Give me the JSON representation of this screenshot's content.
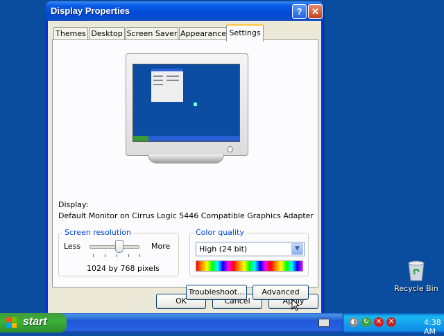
{
  "window": {
    "title": "Display Properties",
    "help_glyph": "?",
    "close_glyph": "✕"
  },
  "tabs": [
    {
      "label": "Themes"
    },
    {
      "label": "Desktop"
    },
    {
      "label": "Screen Saver"
    },
    {
      "label": "Appearance"
    },
    {
      "label": "Settings"
    }
  ],
  "settings": {
    "display_label": "Display:",
    "display_value": "Default Monitor on Cirrus Logic 5446 Compatible Graphics Adapter",
    "resolution": {
      "group_label": "Screen resolution",
      "less": "Less",
      "more": "More",
      "value_text": "1024 by 768 pixels",
      "slider_level": 0.6
    },
    "color_quality": {
      "group_label": "Color quality",
      "selected": "High (24 bit)"
    },
    "troubleshoot_label": "Troubleshoot...",
    "advanced_label": "Advanced"
  },
  "footer": {
    "ok_label": "OK",
    "cancel_label": "Cancel",
    "apply_label": "Apply"
  },
  "desktop": {
    "recycle_bin_label": "Recycle Bin"
  },
  "taskbar": {
    "start_label": "start",
    "clock": "4:38 AM"
  },
  "colors": {
    "desktop": "#0a4d9f",
    "title_bar": "#0049d8",
    "group_label": "#0046d5",
    "start_green": "#3db23a"
  }
}
